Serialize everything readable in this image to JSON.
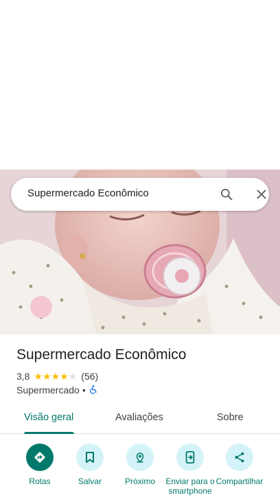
{
  "search": {
    "query": "Supermercado Econômico"
  },
  "place": {
    "name": "Supermercado Econômico",
    "rating": "3,8",
    "stars_filled": 3.8,
    "reviews_count": "(56)",
    "category": "Supermercado",
    "separator": "•"
  },
  "tabs": [
    {
      "label": "Visão geral",
      "active": true
    },
    {
      "label": "Avaliações",
      "active": false
    },
    {
      "label": "Sobre",
      "active": false
    }
  ],
  "actions": [
    {
      "label": "Rotas",
      "icon": "directions-icon"
    },
    {
      "label": "Salvar",
      "icon": "bookmark-icon"
    },
    {
      "label": "Próximo",
      "icon": "nearby-icon"
    },
    {
      "label": "Enviar para o smartphone",
      "icon": "send-to-phone-icon"
    },
    {
      "label": "Compartilhar",
      "icon": "share-icon"
    }
  ],
  "colors": {
    "accent": "#00796b",
    "action_bg": "#d3f3f8",
    "star": "#fbbc04",
    "accessible": "#1a73e8"
  }
}
